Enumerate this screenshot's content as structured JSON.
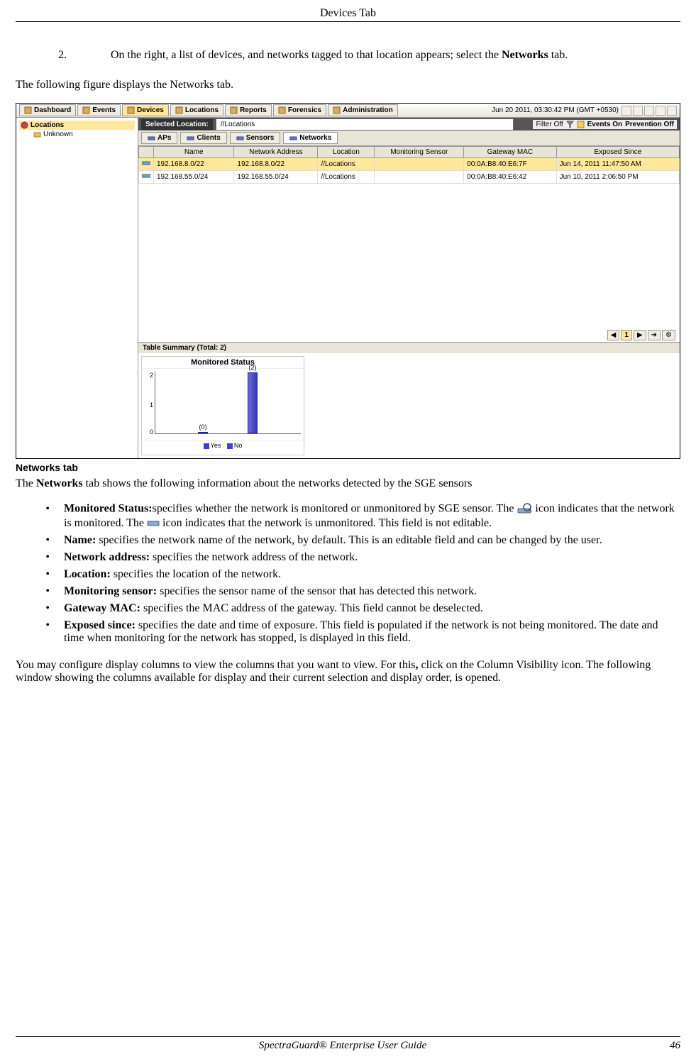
{
  "header": {
    "title": "Devices Tab"
  },
  "step": {
    "number": "2.",
    "text_prefix": "On the right, a list of devices, and networks tagged to that location appears; select the ",
    "bold": "Networks",
    "text_suffix": " tab."
  },
  "intro": "The following figure displays the Networks tab.",
  "figure": {
    "main_tabs": [
      "Dashboard",
      "Events",
      "Devices",
      "Locations",
      "Reports",
      "Forensics",
      "Administration"
    ],
    "active_main_tab": "Devices",
    "timestamp": "Jun 20 2011, 03:30:42 PM (GMT +0530)",
    "sidebar": {
      "root": "Locations",
      "child": "Unknown"
    },
    "selected_location_label": "Selected Location:",
    "selected_location_value": "//Locations",
    "filter_label": "Filter Off",
    "events_label": "Events On",
    "prevention_label": "Prevention Off",
    "sub_tabs": [
      "APs",
      "Clients",
      "Sensors",
      "Networks"
    ],
    "active_sub_tab": "Networks",
    "columns": [
      "Name",
      "Network Address",
      "Location",
      "Monitoring Sensor",
      "Gateway MAC",
      "Exposed Since"
    ],
    "rows": [
      {
        "name": "192.168.8.0/22",
        "addr": "192.168.8.0/22",
        "loc": "//Locations",
        "sensor": "",
        "mac": "00:0A:B8:40:E6:7F",
        "exposed": "Jun 14, 2011 11:47:50 AM"
      },
      {
        "name": "192.168.55.0/24",
        "addr": "192.168.55.0/24",
        "loc": "//Locations",
        "sensor": "",
        "mac": "00:0A:B8:40:E6:42",
        "exposed": "Jun 10, 2011 2:06:50 PM"
      }
    ],
    "paginator_page": "1",
    "summary": "Table Summary (Total: 2)"
  },
  "chart_data": {
    "type": "bar",
    "title": "Monitored Status",
    "categories": [
      "Yes",
      "No"
    ],
    "values": [
      0,
      2
    ],
    "ylim": [
      0,
      2
    ],
    "legend": [
      "Yes",
      "No"
    ],
    "bar_labels": [
      "(0)",
      "(2)"
    ]
  },
  "caption": "Networks tab",
  "post_intro_prefix": "The ",
  "post_intro_bold": "Networks",
  "post_intro_suffix": " tab shows the following information about the networks detected by the SGE sensors",
  "bullets": [
    {
      "label": "Monitored Status:",
      "text1": "specifies whether the network is monitored or unmonitored by SGE sensor. The ",
      "text2": " icon indicates that the network is monitored. The ",
      "text3": " icon indicates that the network is unmonitored. This field is not editable.",
      "has_icons": true
    },
    {
      "label": "Name:",
      "text1": "  specifies the network name of the network, by default. This is an editable field and can be changed by the user."
    },
    {
      "label": "Network address:",
      "text1": " specifies the network address of the network."
    },
    {
      "label": "Location:",
      "text1": " specifies the location of the network."
    },
    {
      "label": "Monitoring sensor:",
      "text1": " specifies the sensor name of the sensor that has detected this network."
    },
    {
      "label": "Gateway MAC:",
      "text1": " specifies the MAC address of the gateway. This field cannot be deselected."
    },
    {
      "label": "Exposed since:",
      "text1": " specifies the date and time of exposure. This field is populated if the network is not being monitored. The date and time when monitoring for the network has stopped, is displayed in this field."
    }
  ],
  "closing_para": {
    "p1": "You may configure display columns to view the columns that you want to view. For this",
    "comma": ",",
    "p2": " click on the Column Visibility icon. The following window showing the columns available for display and their current selection and display order, is opened."
  },
  "footer": {
    "title": "SpectraGuard®  Enterprise User Guide",
    "page": "46"
  }
}
